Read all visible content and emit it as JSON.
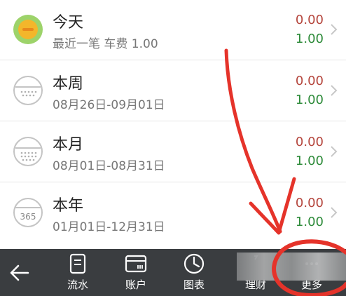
{
  "rows": [
    {
      "title": "今天",
      "subtitle": "最近一笔 车费 1.00",
      "expense": "0.00",
      "income": "1.00"
    },
    {
      "title": "本周",
      "subtitle": "08月26日-09月01日",
      "expense": "0.00",
      "income": "1.00"
    },
    {
      "title": "本月",
      "subtitle": "08月01日-08月31日",
      "expense": "0.00",
      "income": "1.00"
    },
    {
      "title": "本年",
      "subtitle": "01月01日-12月31日",
      "expense": "0.00",
      "income": "1.00",
      "icon_text": "365"
    }
  ],
  "toolbar": {
    "tabs": [
      {
        "label": "流水"
      },
      {
        "label": "账户"
      },
      {
        "label": "图表"
      },
      {
        "label": "理财"
      },
      {
        "label": "更多"
      }
    ]
  },
  "icons": {
    "today": "sun-icon",
    "week": "calendar-icon",
    "month": "calendar-icon",
    "year": "calendar-365-icon",
    "back": "back-arrow-icon",
    "flow": "document-icon",
    "account": "wallet-icon",
    "chart": "clock-chart-icon",
    "finance": "finance-icon",
    "more": "more-icon",
    "chevron": "chevron-right-icon"
  },
  "colors": {
    "expense": "#b5463d",
    "income": "#2e8b3a",
    "toolbar": "#3a3d40",
    "annotation": "#e5332a"
  }
}
